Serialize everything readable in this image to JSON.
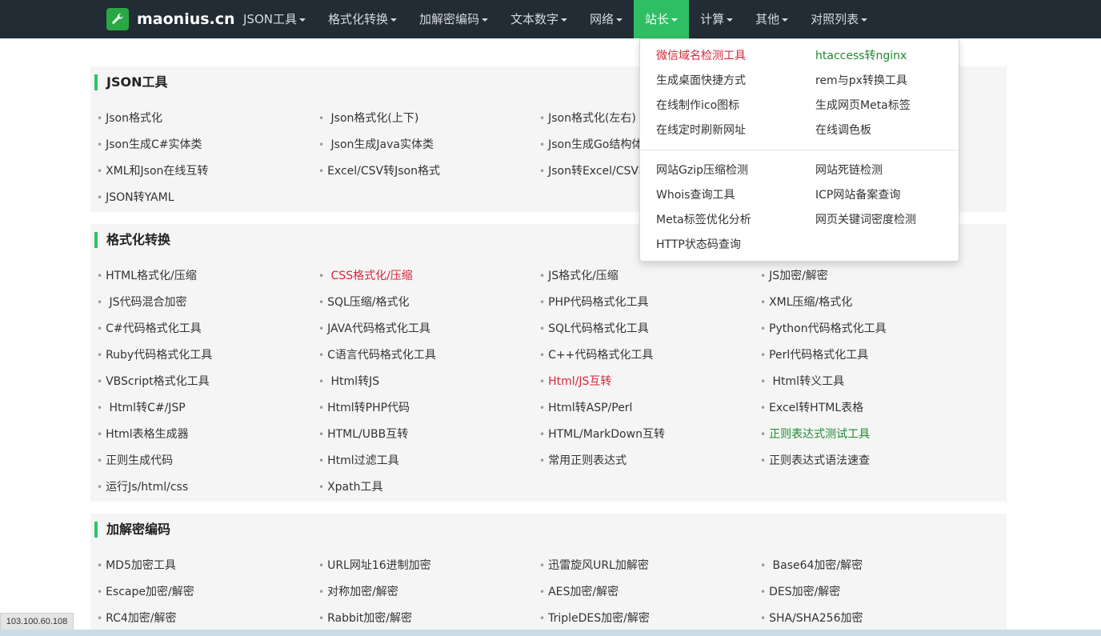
{
  "brand": {
    "name": "maonius.cn",
    "accent": "#2fbe64"
  },
  "nav": [
    {
      "label": "JSON工具",
      "has_caret": true,
      "active": false
    },
    {
      "label": "格式化转换",
      "has_caret": true,
      "active": false
    },
    {
      "label": "加解密编码",
      "has_caret": true,
      "active": false
    },
    {
      "label": "文本数字",
      "has_caret": true,
      "active": false
    },
    {
      "label": "网络",
      "has_caret": true,
      "active": false
    },
    {
      "label": "站长",
      "has_caret": true,
      "active": true
    },
    {
      "label": "计算",
      "has_caret": true,
      "active": false
    },
    {
      "label": "其他",
      "has_caret": true,
      "active": false
    },
    {
      "label": "对照列表",
      "has_caret": true,
      "active": false
    }
  ],
  "dropdown": {
    "group1": [
      {
        "label": "微信域名检测工具",
        "color": "red"
      },
      {
        "label": "htaccess转nginx",
        "color": "green"
      },
      {
        "label": "生成桌面快捷方式",
        "color": ""
      },
      {
        "label": "rem与px转换工具",
        "color": ""
      },
      {
        "label": "在线制作ico图标",
        "color": ""
      },
      {
        "label": "生成网页Meta标签",
        "color": ""
      },
      {
        "label": "在线定时刷新网址",
        "color": ""
      },
      {
        "label": "在线调色板",
        "color": ""
      }
    ],
    "group2": [
      {
        "label": "网站Gzip压缩检测",
        "color": ""
      },
      {
        "label": "网站死链检测",
        "color": ""
      },
      {
        "label": "Whois查询工具",
        "color": ""
      },
      {
        "label": "ICP网站备案查询",
        "color": ""
      },
      {
        "label": "Meta标签优化分析",
        "color": ""
      },
      {
        "label": "网页关键词密度检测",
        "color": ""
      },
      {
        "label": "HTTP状态码查询",
        "color": ""
      }
    ]
  },
  "sections": [
    {
      "title": "JSON工具",
      "tools": [
        {
          "label": "Json格式化",
          "color": ""
        },
        {
          "label": " Json格式化(上下)",
          "color": ""
        },
        {
          "label": "Json格式化(左右)",
          "color": ""
        },
        {
          "label": "",
          "color": ""
        },
        {
          "label": "Json生成C#实体类",
          "color": ""
        },
        {
          "label": " Json生成Java实体类",
          "color": ""
        },
        {
          "label": "Json生成Go结构体",
          "color": ""
        },
        {
          "label": "",
          "color": ""
        },
        {
          "label": "XML和Json在线互转",
          "color": ""
        },
        {
          "label": "Excel/CSV转Json格式",
          "color": ""
        },
        {
          "label": "Json转Excel/CSV格式",
          "color": ""
        },
        {
          "label": "",
          "color": ""
        },
        {
          "label": "JSON转YAML",
          "color": ""
        }
      ]
    },
    {
      "title": "格式化转换",
      "tools": [
        {
          "label": "HTML格式化/压缩",
          "color": ""
        },
        {
          "label": " CSS格式化/压缩",
          "color": "red"
        },
        {
          "label": "JS格式化/压缩",
          "color": ""
        },
        {
          "label": "JS加密/解密",
          "color": ""
        },
        {
          "label": " JS代码混合加密",
          "color": ""
        },
        {
          "label": "SQL压缩/格式化",
          "color": ""
        },
        {
          "label": "PHP代码格式化工具",
          "color": ""
        },
        {
          "label": "XML压缩/格式化",
          "color": ""
        },
        {
          "label": "C#代码格式化工具",
          "color": ""
        },
        {
          "label": "JAVA代码格式化工具",
          "color": ""
        },
        {
          "label": "SQL代码格式化工具",
          "color": ""
        },
        {
          "label": "Python代码格式化工具",
          "color": ""
        },
        {
          "label": "Ruby代码格式化工具",
          "color": ""
        },
        {
          "label": "C语言代码格式化工具",
          "color": ""
        },
        {
          "label": "C++代码格式化工具",
          "color": ""
        },
        {
          "label": "Perl代码格式化工具",
          "color": ""
        },
        {
          "label": "VBScript格式化工具",
          "color": ""
        },
        {
          "label": " Html转JS",
          "color": ""
        },
        {
          "label": "Html/JS互转",
          "color": "red"
        },
        {
          "label": " Html转义工具",
          "color": ""
        },
        {
          "label": " Html转C#/JSP",
          "color": ""
        },
        {
          "label": "Html转PHP代码",
          "color": ""
        },
        {
          "label": "Html转ASP/Perl",
          "color": ""
        },
        {
          "label": "Excel转HTML表格",
          "color": ""
        },
        {
          "label": "Html表格生成器",
          "color": ""
        },
        {
          "label": "HTML/UBB互转",
          "color": ""
        },
        {
          "label": "HTML/MarkDown互转",
          "color": ""
        },
        {
          "label": "正则表达式测试工具",
          "color": "green"
        },
        {
          "label": "正则生成代码",
          "color": ""
        },
        {
          "label": "Html过滤工具",
          "color": ""
        },
        {
          "label": "常用正则表达式",
          "color": ""
        },
        {
          "label": "正则表达式语法速查",
          "color": ""
        },
        {
          "label": "运行Js/html/css",
          "color": ""
        },
        {
          "label": "Xpath工具",
          "color": ""
        }
      ]
    },
    {
      "title": "加解密编码",
      "tools": [
        {
          "label": "MD5加密工具",
          "color": ""
        },
        {
          "label": "URL网址16进制加密",
          "color": ""
        },
        {
          "label": "迅雷旋风URL加解密",
          "color": ""
        },
        {
          "label": " Base64加密/解密",
          "color": ""
        },
        {
          "label": "Escape加密/解密",
          "color": ""
        },
        {
          "label": "对称加密/解密",
          "color": ""
        },
        {
          "label": "AES加密/解密",
          "color": ""
        },
        {
          "label": "DES加密/解密",
          "color": ""
        },
        {
          "label": "RC4加密/解密",
          "color": ""
        },
        {
          "label": "Rabbit加密/解密",
          "color": ""
        },
        {
          "label": "TripleDES加密/解密",
          "color": ""
        },
        {
          "label": "SHA/SHA256加密",
          "color": ""
        }
      ]
    }
  ],
  "status": {
    "ip": "103.100.60.108"
  }
}
